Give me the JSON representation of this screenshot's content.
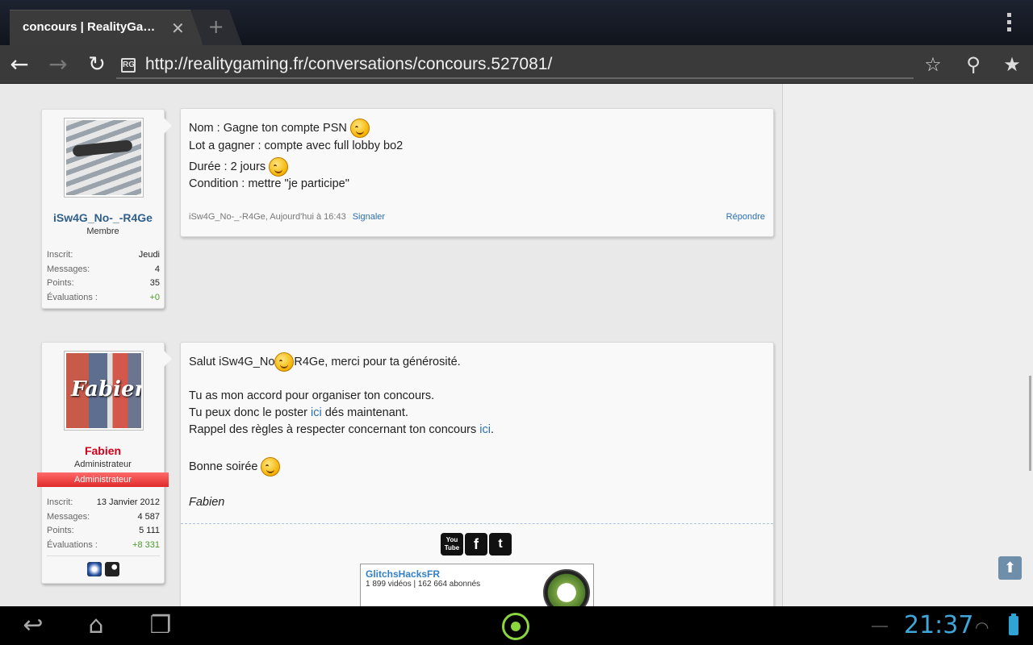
{
  "browser": {
    "tab_title": "concours | RealityGa…",
    "tab_close": "✕",
    "new_tab": "+",
    "url": "http://realitygaming.fr/conversations/concours.527081/",
    "favicon": "RG"
  },
  "posts": [
    {
      "user": {
        "name": "iSw4G_No-_-R4Ge",
        "name_color": "#2f5f8a",
        "title": "Membre",
        "stats": [
          {
            "label": "Inscrit:",
            "value": "Jeudi"
          },
          {
            "label": "Messages:",
            "value": "4"
          },
          {
            "label": "Points:",
            "value": "35"
          },
          {
            "label": "Évaluations :",
            "value": "+0"
          }
        ]
      },
      "body": {
        "line1": "Nom : Gagne ton compte PSN ",
        "line2": "Lot a gagner : compte avec full lobby bo2",
        "line3": "Durée : 2 jours ",
        "line4": "Condition : mettre \"je participe\""
      },
      "meta": "iSw4G_No-_-R4Ge, Aujourd'hui à 16:43",
      "report": "Signaler",
      "reply": "Répondre"
    },
    {
      "user": {
        "name": "Fabien",
        "name_color": "#d0021b",
        "title": "Administrateur",
        "role_badge": "Administrateur",
        "avatar_text": "Fabien",
        "stats": [
          {
            "label": "Inscrit:",
            "value": "13 Janvier 2012"
          },
          {
            "label": "Messages:",
            "value": "4 587"
          },
          {
            "label": "Points:",
            "value": "5 111"
          },
          {
            "label": "Évaluations :",
            "value": "+8 331"
          }
        ],
        "badge_icons": [
          "psn-icon",
          "steam-icon"
        ]
      },
      "body": {
        "l1a": "Salut iSw4G_No",
        "l1b": "R4Ge, merci pour ta générosité.",
        "l2": "Tu as mon accord pour organiser ton concours.",
        "l3a": "Tu peux donc le poster ",
        "l3link": "ici",
        "l3b": " dés maintenant.",
        "l4a": "Rappel des règles à respecter concernant ton concours ",
        "l4link": "ici",
        "l4b": ".",
        "l5": "Bonne soirée ",
        "l6": "Fabien"
      },
      "signature": {
        "social": [
          "You Tube",
          "f",
          "t"
        ],
        "yt_channel": "GlitchsHacksFR",
        "yt_stats": "1 899 vidéos | 162 664 abonnés"
      }
    }
  ],
  "system": {
    "clock": "21:37"
  }
}
